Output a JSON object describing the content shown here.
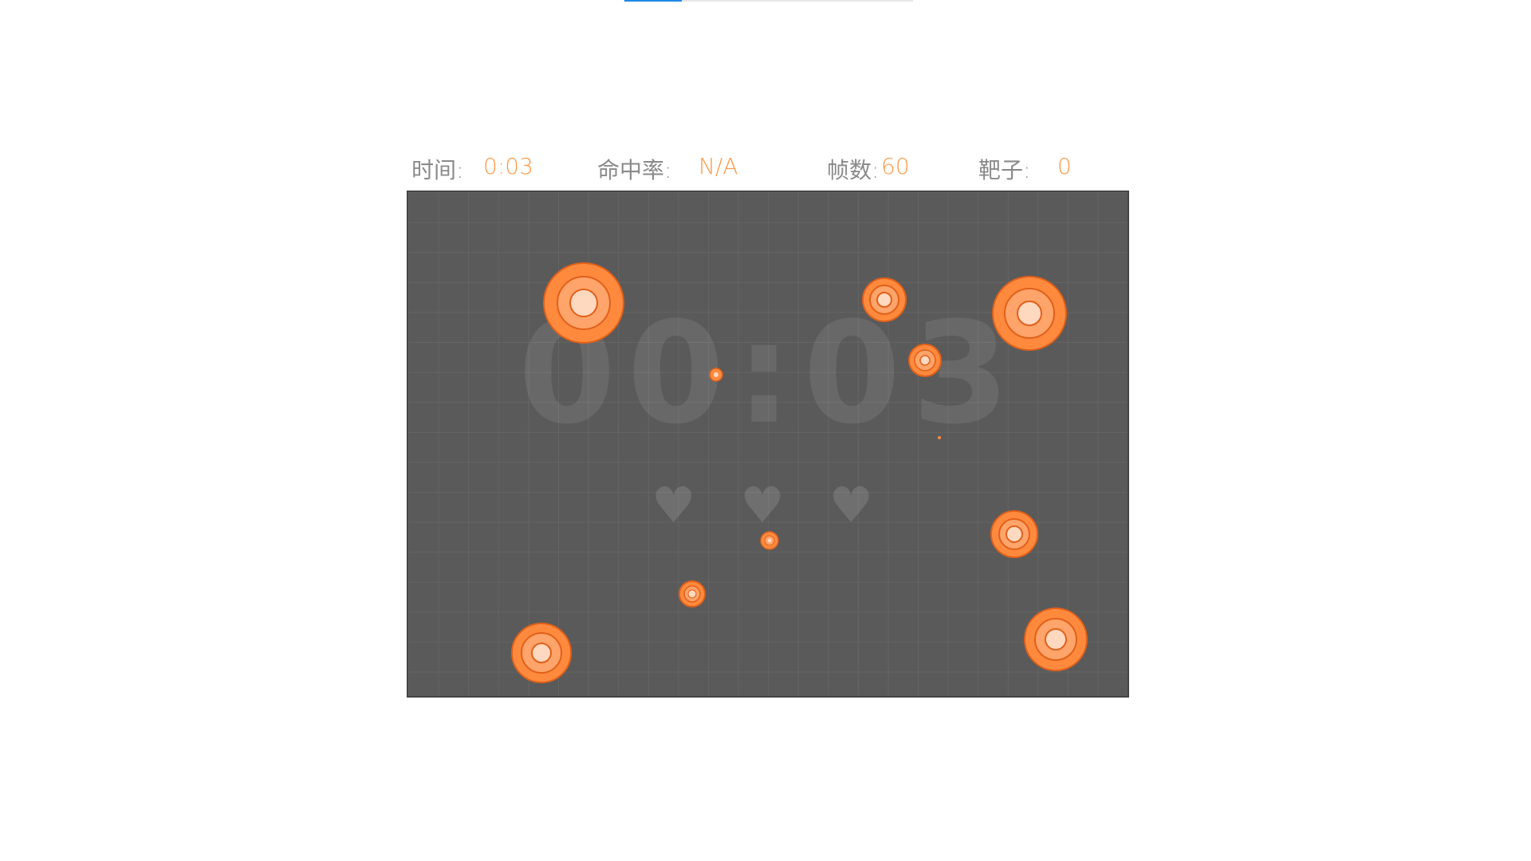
{
  "stats": {
    "time_label": "时间:",
    "time_value": "0:03",
    "accuracy_label": "命中率:",
    "accuracy_value": "N/A",
    "fps_label": "帧数:",
    "fps_value": "60",
    "targets_label": "靶子:",
    "targets_value": "0"
  },
  "board": {
    "big_timer": "00:03",
    "lives_icon": "heart-icon",
    "lives_count": 3,
    "lives": [
      "♥",
      "♥",
      "♥"
    ]
  },
  "colors": {
    "accent": "#ff9a4a",
    "target_outer": "#ff8a3d",
    "target_mid": "#ffa46a",
    "target_inner": "#ffd8c0",
    "target_stroke": "#e0601a",
    "board_bg": "#5a5a5a",
    "tab_active": "#1e88e5"
  }
}
